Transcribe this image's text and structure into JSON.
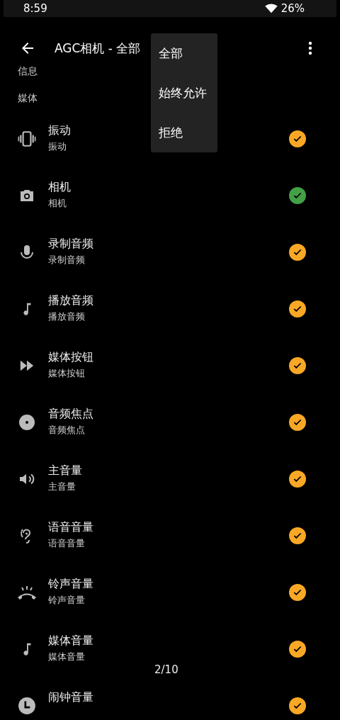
{
  "status_bar": {
    "time": "8:59",
    "battery": "26%"
  },
  "app_bar": {
    "title": "AGC相机 - 全部"
  },
  "sections": [
    "信息",
    "媒体"
  ],
  "popup_menu": {
    "items": [
      "全部",
      "始终允许",
      "拒绝"
    ]
  },
  "permissions": [
    {
      "title": "振动",
      "subtitle": "振动",
      "color": "#f9a825"
    },
    {
      "title": "相机",
      "subtitle": "相机",
      "color": "#43a047"
    },
    {
      "title": "录制音频",
      "subtitle": "录制音频",
      "color": "#f9a825"
    },
    {
      "title": "播放音频",
      "subtitle": "播放音频",
      "color": "#f9a825"
    },
    {
      "title": "媒体按钮",
      "subtitle": "媒体按钮",
      "color": "#f9a825"
    },
    {
      "title": "音频焦点",
      "subtitle": "音频焦点",
      "color": "#f9a825"
    },
    {
      "title": "主音量",
      "subtitle": "主音量",
      "color": "#f9a825"
    },
    {
      "title": "语音音量",
      "subtitle": "语音音量",
      "color": "#f9a825"
    },
    {
      "title": "铃声音量",
      "subtitle": "铃声音量",
      "color": "#f9a825"
    },
    {
      "title": "媒体音量",
      "subtitle": "媒体音量",
      "color": "#f9a825"
    },
    {
      "title": "闹钟音量",
      "color": "#f9a825"
    }
  ],
  "page_indicator": "2/10"
}
